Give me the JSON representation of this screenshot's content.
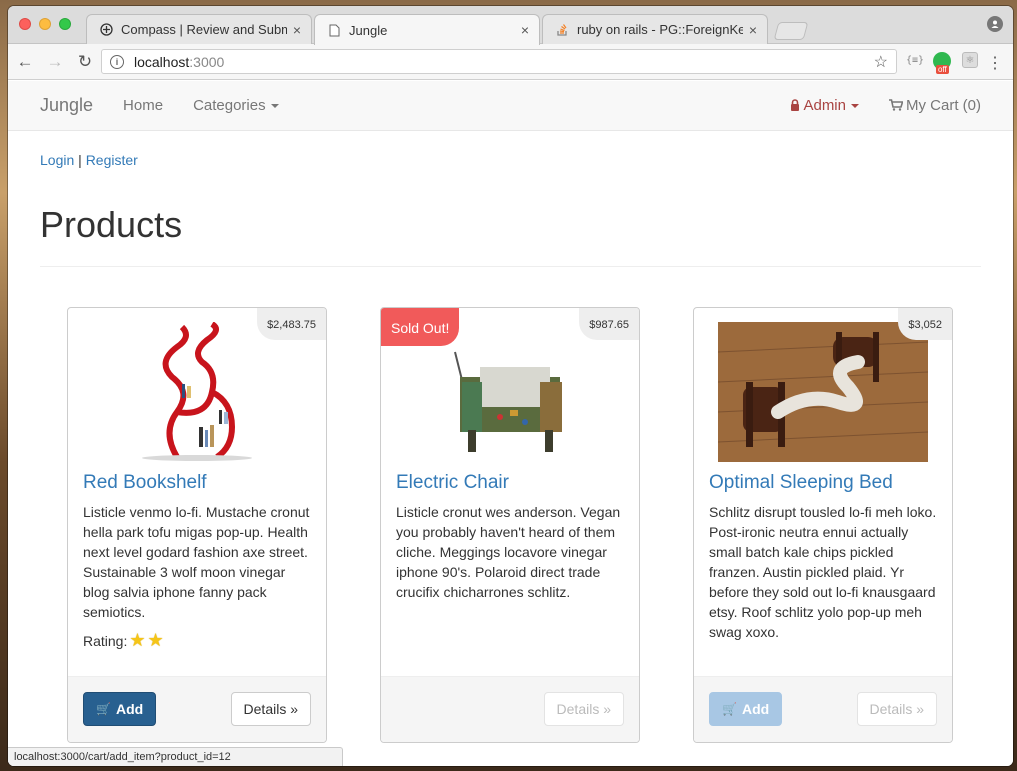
{
  "browser": {
    "tabs": [
      {
        "title": "Compass | Review and Submit",
        "icon": "compass-icon",
        "active": false
      },
      {
        "title": "Jungle",
        "icon": "page-icon",
        "active": true
      },
      {
        "title": "ruby on rails - PG::ForeignKey",
        "icon": "stackoverflow-icon",
        "active": false
      }
    ],
    "close_glyph": "×",
    "url_host": "localhost",
    "url_port": ":3000",
    "info_glyph": "i",
    "status_url": "localhost:3000/cart/add_item?product_id=12",
    "ext_json_label": "{≡}",
    "ext_off_label": "off"
  },
  "navbar": {
    "brand": "Jungle",
    "home": "Home",
    "categories": "Categories",
    "admin": "Admin",
    "cart": "My Cart (0)"
  },
  "auth": {
    "login": "Login",
    "separator": "|",
    "register": "Register"
  },
  "page_title": "Products",
  "products": [
    {
      "name": "Red Bookshelf",
      "price": "$2,483.75",
      "description": "Listicle venmo lo-fi. Mustache cronut hella park tofu migas pop-up. Health next level godard fashion axe street. Sustainable 3 wolf moon vinegar blog salvia iphone fanny pack semiotics.",
      "rating_label": "Rating:",
      "rating_stars": 2,
      "sold_out": false,
      "add_label": "Add",
      "add_disabled": false,
      "details_label": "Details »",
      "details_disabled": false
    },
    {
      "name": "Electric Chair",
      "price": "$987.65",
      "description": "Listicle cronut wes anderson. Vegan you probably haven't heard of them cliche. Meggings locavore vinegar iphone 90's. Polaroid direct trade crucifix chicharrones schlitz.",
      "sold_out": true,
      "sold_out_label": "Sold Out!",
      "details_label": "Details »",
      "details_disabled": true
    },
    {
      "name": "Optimal Sleeping Bed",
      "price": "$3,052",
      "description": "Schlitz disrupt tousled lo-fi meh loko. Post-ironic neutra ennui actually small batch kale chips pickled franzen. Austin pickled plaid. Yr before they sold out lo-fi knausgaard etsy. Roof schlitz yolo pop-up meh swag xoxo.",
      "sold_out": false,
      "add_label": "Add",
      "add_disabled": true,
      "details_label": "Details »",
      "details_disabled": true
    }
  ],
  "colors": {
    "link": "#337ab7",
    "admin": "#a94442",
    "sold_out": "#f15a5a",
    "add_button": "#286090"
  }
}
